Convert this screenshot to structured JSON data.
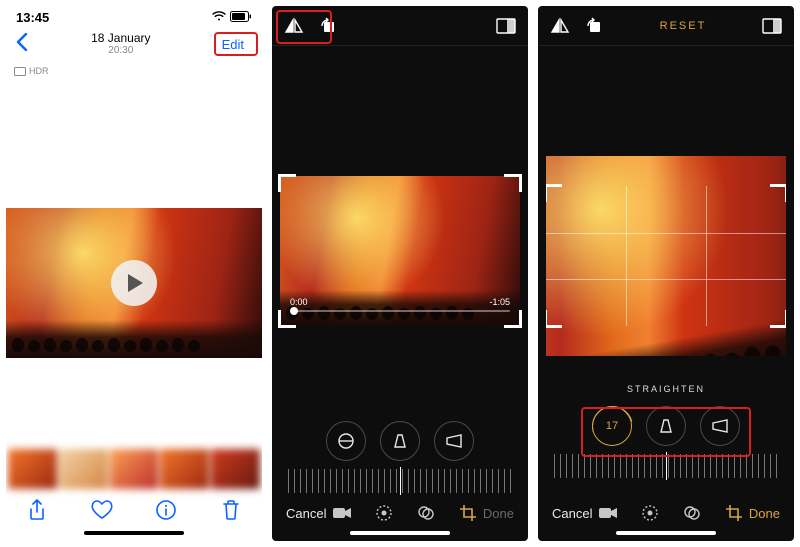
{
  "panel1": {
    "status": {
      "time": "13:45"
    },
    "title": "18 January",
    "subtitle": "20:30",
    "edit": "Edit",
    "hdr": "HDR"
  },
  "panel2": {
    "timeline": {
      "start": "0:00",
      "end": "-1:05"
    },
    "cancel": "Cancel",
    "done": "Done"
  },
  "panel3": {
    "reset": "RESET",
    "adjust_label": "STRAIGHTEN",
    "straighten_value": "17",
    "cancel": "Cancel",
    "done": "Done"
  }
}
